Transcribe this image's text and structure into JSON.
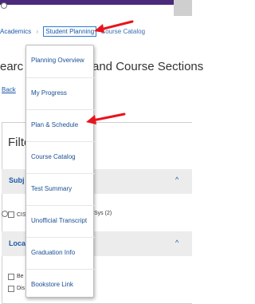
{
  "breadcrumb": {
    "academics": "Academics",
    "student_planning": "Student Planning",
    "course_catalog": "Course Catalog"
  },
  "page": {
    "heading_left": "earc",
    "heading_right": "and Course Sections",
    "back_link": "Back"
  },
  "filters": {
    "title": "Filte",
    "subject_label": "Subj",
    "subject_option": "CIS",
    "subject_option_suffix": "Sys (2)",
    "location_label": "Loca",
    "location_options": [
      "Be",
      "Dis"
    ]
  },
  "menu": {
    "items": [
      "Planning Overview",
      "My Progress",
      "Plan & Schedule",
      "Course Catalog",
      "Test Summary",
      "Unofficial Transcript",
      "Graduation Info",
      "Bookstore Link"
    ]
  },
  "colors": {
    "accent_arrow": "#e8141b",
    "link_blue": "#1a5aa6",
    "brand_purple": "#4b2a7b"
  }
}
